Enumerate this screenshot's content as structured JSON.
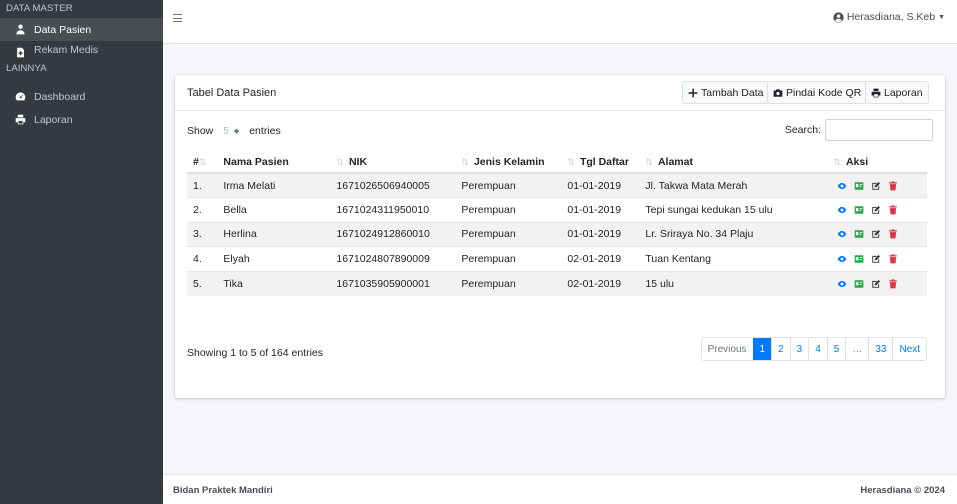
{
  "sidebar": {
    "section_master": "DATA MASTER",
    "items_master": [
      {
        "label": "Data Pasien",
        "icon": "user-injured-icon",
        "active": true
      },
      {
        "label": "Rekam Medis",
        "icon": "file-medical-icon",
        "active": false
      }
    ],
    "section_other": "LAINNYA",
    "items_other": [
      {
        "label": "Dashboard",
        "icon": "tachometer-icon",
        "active": false
      },
      {
        "label": "Laporan",
        "icon": "print-icon",
        "active": false
      }
    ]
  },
  "topbar": {
    "menu_icon": "hamburger-icon",
    "user_name": "Herasdiana, S.Keb",
    "user_icon": "user-circle-icon"
  },
  "card": {
    "title": "Tabel Data Pasien",
    "buttons": {
      "add": "Tambah Data",
      "scan": "Pindai Kode QR",
      "report": "Laporan"
    }
  },
  "controls": {
    "show_label": "Show",
    "entries_value": "5",
    "entries_label": "entries",
    "search_label": "Search:",
    "search_value": ""
  },
  "table": {
    "headers": [
      "#",
      "Nama Pasien",
      "NIK",
      "Jenis Kelamin",
      "Tgl Daftar",
      "Alamat",
      "Aksi"
    ],
    "rows": [
      [
        "1.",
        "Irma Melati",
        "1671026506940005",
        "Perempuan",
        "01-01-2019",
        "Jl. Takwa Mata Merah"
      ],
      [
        "2.",
        "Bella",
        "1671024311950010",
        "Perempuan",
        "01-01-2019",
        "Tepi sungai kedukan 15 ulu"
      ],
      [
        "3.",
        "Herlina",
        "1671024912860010",
        "Perempuan",
        "01-01-2019",
        "Lr. Sriraya No. 34 Plaju"
      ],
      [
        "4.",
        "Elyah",
        "1671024807890009",
        "Perempuan",
        "02-01-2019",
        "Tuan Kentang"
      ],
      [
        "5.",
        "Tika",
        "1671035905900001",
        "Perempuan",
        "02-01-2019",
        "15 ulu"
      ]
    ],
    "action_icons": [
      "eye-icon",
      "qrcode-card-icon",
      "edit-icon",
      "trash-icon"
    ],
    "colors": {
      "view": "#007bff",
      "qr": "#28a745",
      "edit": "#343a40",
      "delete": "#dc3545"
    }
  },
  "footer_info": "Showing 1 to 5 of 164 entries",
  "pagination": {
    "previous": "Previous",
    "pages": [
      "1",
      "2",
      "3",
      "4",
      "5",
      "…",
      "33"
    ],
    "active": "1",
    "next": "Next"
  },
  "footer": {
    "left": "Bidan Praktek Mandiri",
    "right": "Herasdiana © 2024"
  }
}
